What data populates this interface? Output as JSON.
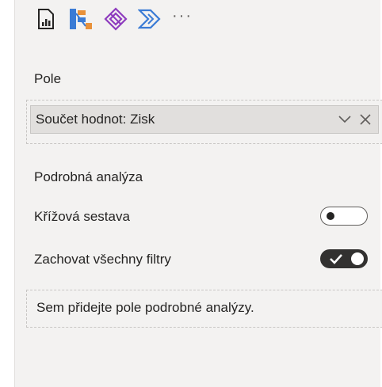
{
  "toolbar": {
    "icons": [
      "bar-chart-page-icon",
      "decomposition-tree-icon",
      "power-apps-icon",
      "power-automate-icon"
    ],
    "more": "···"
  },
  "fields": {
    "section_label": "Pole",
    "pill_value": "Součet hodnot: Zisk"
  },
  "drillthrough": {
    "section_label": "Podrobná analýza",
    "cross_report_label": "Křížová sestava",
    "cross_report_on": false,
    "keep_filters_label": "Zachovat všechny filtry",
    "keep_filters_on": true,
    "drop_placeholder": "Sem přidejte pole podrobné analýzy."
  },
  "colors": {
    "pane_bg": "#f3f2f1",
    "accent_orange": "#e8913a",
    "accent_blue": "#3a7bd5",
    "accent_purple": "#8e3cbe",
    "toggle_on": "#323130"
  }
}
